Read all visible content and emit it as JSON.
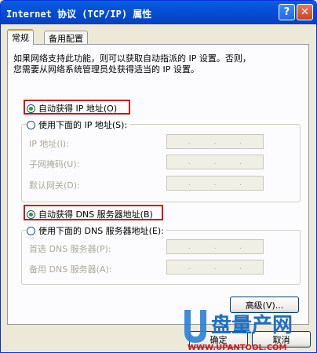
{
  "window": {
    "title": "Internet 协议 (TCP/IP) 属性",
    "help_glyph": "?",
    "close_glyph": "✕"
  },
  "tabs": [
    {
      "label": "常规"
    },
    {
      "label": "备用配置"
    }
  ],
  "description": [
    "如果网络支持此功能，则可以获取自动指派的 IP 设置。否则，",
    "您需要从网络系统管理员处获得适当的 IP 设置。"
  ],
  "ip": {
    "auto_label": "自动获得 IP 地址(O)",
    "manual_label": "使用下面的 IP 地址(S):",
    "fields": [
      {
        "label": "IP 地址(I):"
      },
      {
        "label": "子网掩码(U):"
      },
      {
        "label": "默认网关(D):"
      }
    ]
  },
  "dns": {
    "auto_label": "自动获得 DNS 服务器地址(B)",
    "manual_label": "使用下面的 DNS 服务器地址(E):",
    "fields": [
      {
        "label": "首选 DNS 服务器(P):"
      },
      {
        "label": "备用 DNS 服务器(A):"
      }
    ]
  },
  "buttons": {
    "advanced": "高级(V)...",
    "ok": "确定",
    "cancel": "取消"
  },
  "ip_dots": ".",
  "watermark": {
    "brand": "盘量产网",
    "url": "WWW.UPANTOOL.COM"
  },
  "colors": {
    "highlight": "#d01010",
    "title_bar": "#0550d8",
    "radio_dot": "#21a121"
  }
}
